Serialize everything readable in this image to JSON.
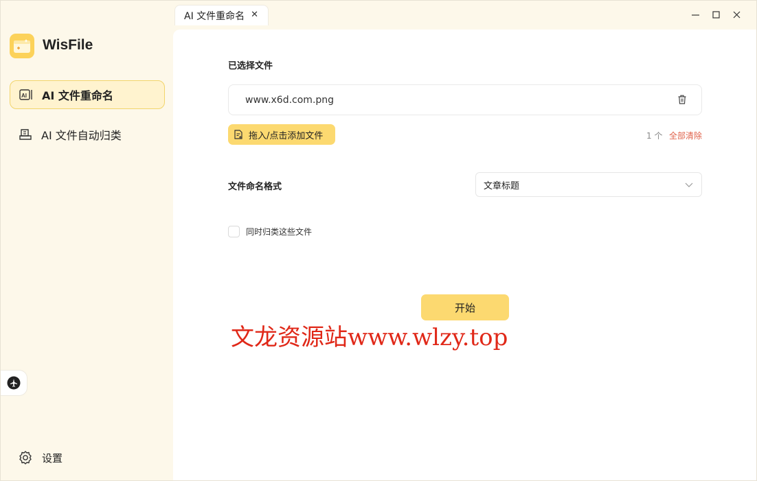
{
  "tab": {
    "title": "AI 文件重命名"
  },
  "app": {
    "name": "WisFile"
  },
  "sidebar": {
    "items": [
      {
        "label": "AI 文件重命名",
        "icon": "ai-rename-icon",
        "active": true
      },
      {
        "label": "AI 文件自动归类",
        "icon": "archive-icon",
        "active": false
      }
    ],
    "settings_label": "设置"
  },
  "main": {
    "selected_files_title": "已选择文件",
    "files": [
      {
        "name": "www.x6d.com.png"
      }
    ],
    "add_button_label": "拖入/点击添加文件",
    "count_text": "1 个",
    "clear_all_label": "全部清除",
    "format_label": "文件命名格式",
    "format_value": "文章标题",
    "classify_checkbox_label": "同时归类这些文件",
    "start_button_label": "开始"
  },
  "watermark": {
    "text": "文龙资源站www.wlzy.top"
  },
  "colors": {
    "accent": "#fcd970",
    "sidebar_bg": "#fdf8ea",
    "danger": "#e0624a",
    "watermark": "#e02818"
  }
}
